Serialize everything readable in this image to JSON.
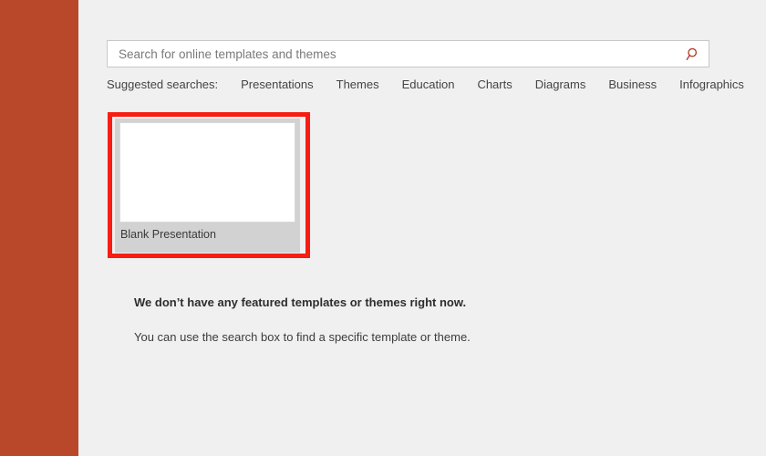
{
  "colors": {
    "sidebar_accent": "#b9472a",
    "background": "#f0f0f0",
    "highlight_box": "#f71d12",
    "card_background": "#d2d2d2",
    "search_icon": "#b0402b"
  },
  "sidebar": {
    "accent_color": "#b9472a"
  },
  "search": {
    "placeholder": "Search for online templates and themes",
    "value": "",
    "button_label": "Search",
    "icon": "search-icon"
  },
  "suggested": {
    "label": "Suggested searches:",
    "links": [
      {
        "label": "Presentations"
      },
      {
        "label": "Themes"
      },
      {
        "label": "Education"
      },
      {
        "label": "Charts"
      },
      {
        "label": "Diagrams"
      },
      {
        "label": "Business"
      },
      {
        "label": "Infographics"
      }
    ]
  },
  "templates": [
    {
      "label": "Blank Presentation",
      "selected": true
    }
  ],
  "empty_state": {
    "primary": "We don’t have any featured templates or themes right now.",
    "secondary": "You can use the search box to find a specific template or theme."
  }
}
